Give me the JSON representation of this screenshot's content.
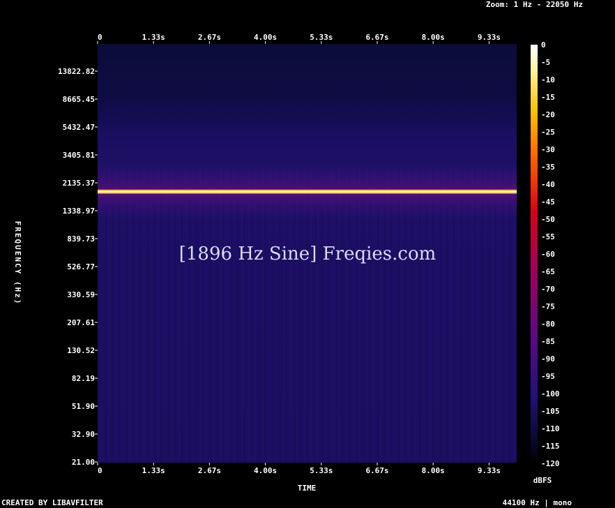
{
  "header": {
    "zoom_label": "Zoom: 1 Hz - 22050 Hz"
  },
  "footer": {
    "credit": "CREATED BY LIBAVFILTER",
    "format": "44100 Hz | mono"
  },
  "watermark": "[1896 Hz Sine] Freqies.com",
  "chart_data": {
    "type": "heatmap",
    "title": "",
    "xlabel": "TIME",
    "ylabel": "FREQUENCY (Hz)",
    "x_ticks": [
      "0",
      "1.33s",
      "2.67s",
      "4.00s",
      "5.33s",
      "6.67s",
      "8.00s",
      "9.33s"
    ],
    "x_range_seconds": [
      0,
      10
    ],
    "y_scale": "log",
    "y_ticks": [
      "13822.82",
      "8665.45",
      "5432.47",
      "3405.81",
      "2135.37",
      "1338.97",
      "839.73",
      "526.77",
      "330.59",
      "207.61",
      "130.52",
      "82.19",
      "51.90",
      "32.90",
      "21.00"
    ],
    "y_range_hz": [
      21,
      22050
    ],
    "tone": {
      "frequency_hz": 1896,
      "level_dbfs": 0
    },
    "colorbar": {
      "label": "dBFS",
      "ticks": [
        "0",
        "-5",
        "-10",
        "-15",
        "-20",
        "-25",
        "-30",
        "-35",
        "-40",
        "-45",
        "-50",
        "-55",
        "-60",
        "-65",
        "-70",
        "-75",
        "-80",
        "-85",
        "-90",
        "-95",
        "-100",
        "-105",
        "-110",
        "-115",
        "-120"
      ],
      "range_dbfs": [
        -120,
        0
      ]
    },
    "colors": {
      "background": "#000000",
      "floor": "#1e1064",
      "tone": "#fffbe0"
    }
  }
}
